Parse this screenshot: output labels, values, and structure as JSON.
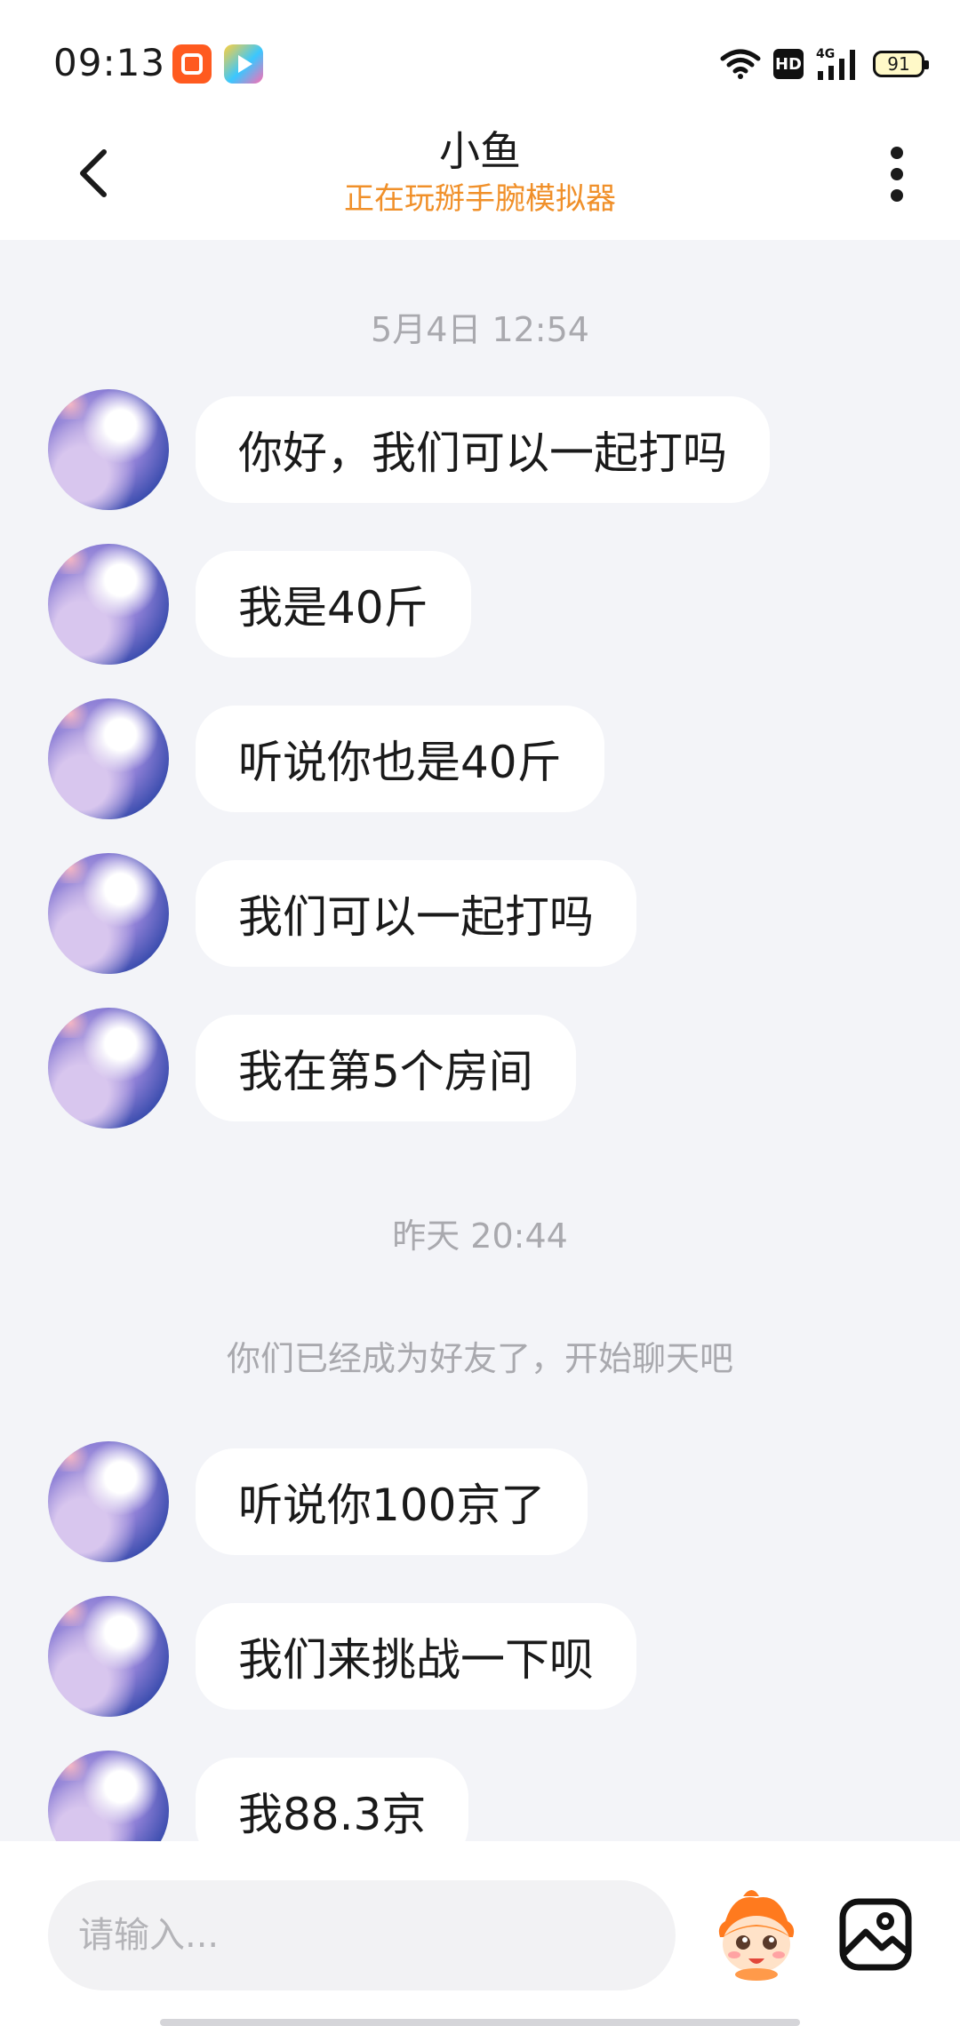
{
  "status_bar": {
    "time": "09:13",
    "network": "4G",
    "hd": "HD",
    "battery": "91"
  },
  "header": {
    "title": "小鱼",
    "subtitle": "正在玩掰手腕模拟器"
  },
  "chat": {
    "timestamp_1": "5月4日 12:54",
    "timestamp_2": "昨天 20:44",
    "system_message": "你们已经成为好友了，开始聊天吧",
    "messages": [
      {
        "text": "你好，我们可以一起打吗"
      },
      {
        "text": "我是40斤"
      },
      {
        "text": "听说你也是40斤"
      },
      {
        "text": "我们可以一起打吗"
      },
      {
        "text": "我在第5个房间"
      },
      {
        "text": "听说你100京了"
      },
      {
        "text": "我们来挑战一下呗"
      },
      {
        "text": "我88.3京"
      }
    ]
  },
  "input": {
    "placeholder": "请输入..."
  },
  "colors": {
    "accent_orange": "#f0902a",
    "background": "#f3f4f8",
    "bubble": "#ffffff"
  }
}
